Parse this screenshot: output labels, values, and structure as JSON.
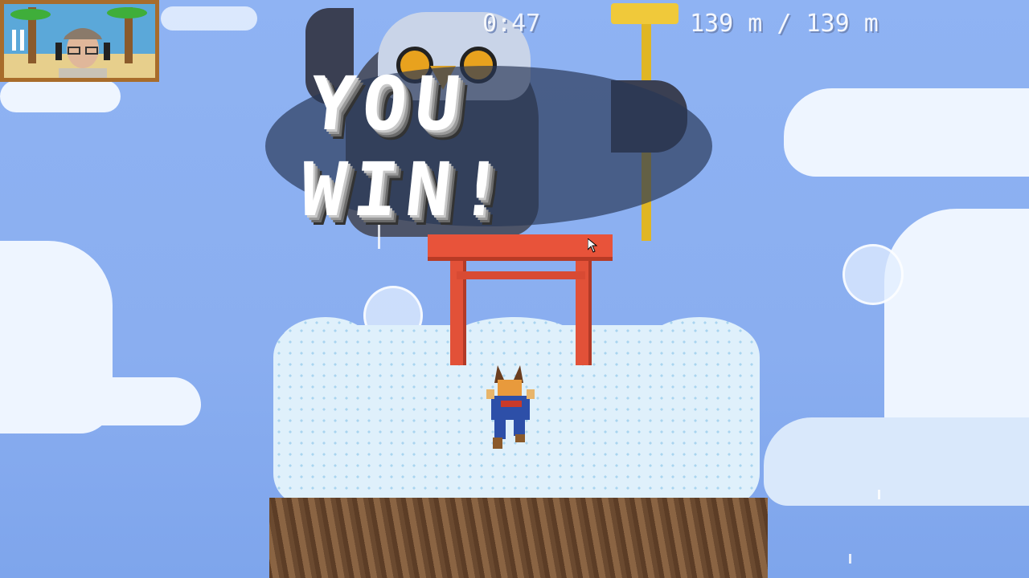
{
  "hud": {
    "timer": "0:47",
    "distance": "139 m / 139 m"
  },
  "banner": {
    "text": "YOU WIN!"
  },
  "colors": {
    "sky": "#8aaef0",
    "torii": "#e8533a",
    "snow": "#dff0fb",
    "dirt": "#7a5436",
    "banner_backdrop": "#283755"
  },
  "icons": {
    "pause": "pause-icon",
    "cursor": "mouse-cursor-icon"
  }
}
